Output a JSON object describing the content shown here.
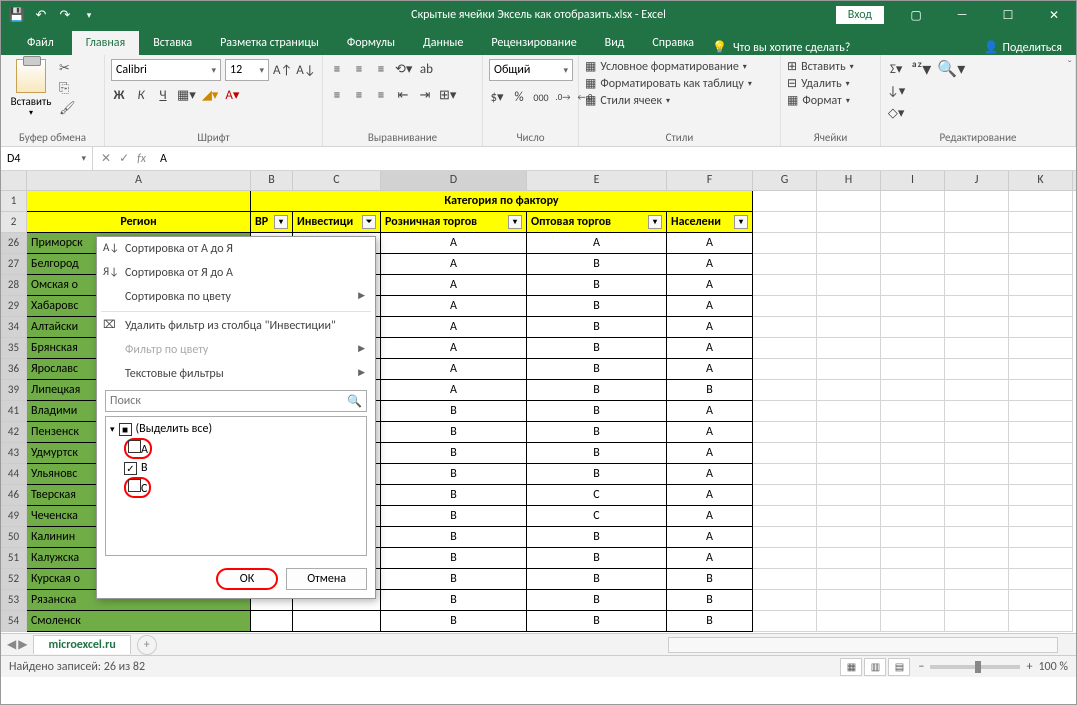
{
  "window": {
    "title": "Скрытые ячейки Эксель как отобразить.xlsx - Excel",
    "login": "Вход"
  },
  "tabs": {
    "file": "Файл",
    "home": "Главная",
    "insert": "Вставка",
    "layout": "Разметка страницы",
    "formulas": "Формулы",
    "data": "Данные",
    "review": "Рецензирование",
    "view": "Вид",
    "help": "Справка",
    "tellme": "Что вы хотите сделать?",
    "share": "Поделиться"
  },
  "ribbon": {
    "clipboard": {
      "paste": "Вставить",
      "label": "Буфер обмена"
    },
    "font": {
      "name": "Calibri",
      "size": "12",
      "label": "Шрифт"
    },
    "align": {
      "label": "Выравнивание"
    },
    "number": {
      "format": "Общий",
      "label": "Число"
    },
    "styles": {
      "cond": "Условное форматирование",
      "table": "Форматировать как таблицу",
      "cell": "Стили ячеек",
      "label": "Стили"
    },
    "cells": {
      "insert": "Вставить",
      "delete": "Удалить",
      "format": "Формат",
      "label": "Ячейки"
    },
    "editing": {
      "label": "Редактирование"
    }
  },
  "namebox": "D4",
  "formula": "A",
  "columns": [
    "A",
    "B",
    "C",
    "D",
    "E",
    "F",
    "G",
    "H",
    "I",
    "J",
    "K"
  ],
  "header": {
    "region": "Регион",
    "category": "Категория по фактору",
    "cols": [
      "ВР",
      "Инвестици",
      "Розничная торгов",
      "Оптовая торгов",
      "Населени"
    ]
  },
  "rows": [
    {
      "n": 26,
      "a": "Приморск",
      "d": "A",
      "e": "A",
      "f": "A"
    },
    {
      "n": 27,
      "a": "Белгород",
      "d": "A",
      "e": "B",
      "f": "A"
    },
    {
      "n": 28,
      "a": "Омская о",
      "d": "A",
      "e": "B",
      "f": "A"
    },
    {
      "n": 29,
      "a": "Хабаровс",
      "d": "A",
      "e": "B",
      "f": "A"
    },
    {
      "n": 34,
      "a": "Алтайски",
      "d": "A",
      "e": "B",
      "f": "A"
    },
    {
      "n": 35,
      "a": "Брянская",
      "d": "A",
      "e": "B",
      "f": "A"
    },
    {
      "n": 36,
      "a": "Ярославс",
      "d": "A",
      "e": "B",
      "f": "A"
    },
    {
      "n": 39,
      "a": "Липецкая",
      "d": "A",
      "e": "B",
      "f": "B"
    },
    {
      "n": 41,
      "a": "Владими",
      "d": "B",
      "e": "B",
      "f": "A"
    },
    {
      "n": 42,
      "a": "Пензенск",
      "d": "B",
      "e": "B",
      "f": "A"
    },
    {
      "n": 43,
      "a": "Удмуртск",
      "d": "B",
      "e": "B",
      "f": "A"
    },
    {
      "n": 44,
      "a": "Ульяновс",
      "d": "B",
      "e": "B",
      "f": "A"
    },
    {
      "n": 46,
      "a": "Тверская",
      "d": "B",
      "e": "C",
      "f": "A"
    },
    {
      "n": 49,
      "a": "Чеченска",
      "d": "B",
      "e": "C",
      "f": "A"
    },
    {
      "n": 50,
      "a": "Калинин",
      "d": "B",
      "e": "B",
      "f": "A"
    },
    {
      "n": 51,
      "a": "Калужска",
      "d": "B",
      "e": "B",
      "f": "A"
    },
    {
      "n": 52,
      "a": "Курская о",
      "d": "B",
      "e": "B",
      "f": "B"
    },
    {
      "n": 53,
      "a": "Рязанска",
      "d": "B",
      "e": "B",
      "f": "B"
    },
    {
      "n": 54,
      "a": "Смоленск",
      "d": "B",
      "e": "B",
      "f": "B"
    }
  ],
  "filter": {
    "sortAZ": "Сортировка от А до Я",
    "sortZA": "Сортировка от Я до А",
    "sortColor": "Сортировка по цвету",
    "clear": "Удалить фильтр из столбца \"Инвестиции\"",
    "filterColor": "Фильтр по цвету",
    "textFilters": "Текстовые фильтры",
    "search": "Поиск",
    "selectAll": "(Выделить все)",
    "opts": [
      "A",
      "B",
      "C"
    ],
    "ok": "ОК",
    "cancel": "Отмена"
  },
  "sheet": "microexcel.ru",
  "status": {
    "found": "Найдено записей: 26 из 82",
    "zoom": "100 %"
  }
}
